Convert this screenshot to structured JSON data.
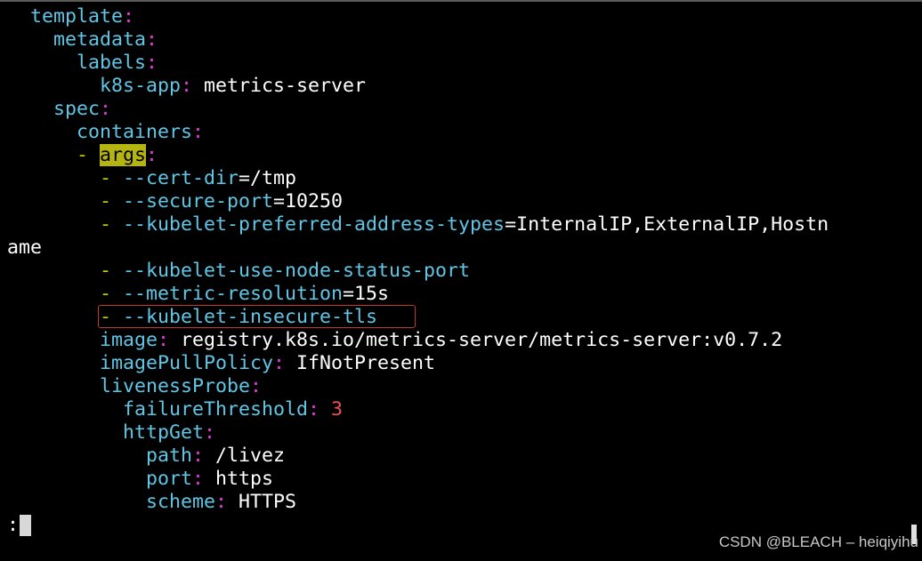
{
  "lines": [
    {
      "indent": "  ",
      "key": "template",
      "colon": ":"
    },
    {
      "indent": "    ",
      "key": "metadata",
      "colon": ":"
    },
    {
      "indent": "      ",
      "key": "labels",
      "colon": ":"
    },
    {
      "indent": "        ",
      "key": "k8s-app",
      "colon": ":",
      "value": " metrics-server"
    },
    {
      "indent": "    ",
      "key": "spec",
      "colon": ":"
    },
    {
      "indent": "      ",
      "key": "containers",
      "colon": ":"
    },
    {
      "indent": "      ",
      "dash": "- ",
      "key_hl": "args",
      "colon": ":"
    },
    {
      "indent": "        ",
      "dash": "- ",
      "flag": "--cert-dir",
      "value": "=/tmp"
    },
    {
      "indent": "        ",
      "dash": "- ",
      "flag": "--secure-port",
      "value": "=10250"
    },
    {
      "indent": "        ",
      "dash": "- ",
      "flag": "--kubelet-preferred-address-types",
      "value": "=InternalIP,ExternalIP,Hostn"
    },
    {
      "plain": "ame"
    },
    {
      "indent": "        ",
      "dash": "- ",
      "flag": "--kubelet-use-node-status-port"
    },
    {
      "indent": "        ",
      "dash": "- ",
      "flag": "--metric-resolution",
      "value": "=15s"
    },
    {
      "indent": "        ",
      "dash": "- ",
      "flag": "--kubelet-insecure-tls",
      "boxed": true
    },
    {
      "indent": "        ",
      "key": "image",
      "colon": ":",
      "value": " registry.k8s.io/metrics-server/metrics-server:v0.7.2"
    },
    {
      "indent": "        ",
      "key": "imagePullPolicy",
      "colon": ":",
      "value": " IfNotPresent"
    },
    {
      "indent": "        ",
      "key": "livenessProbe",
      "colon": ":"
    },
    {
      "indent": "          ",
      "key": "failureThreshold",
      "colon": ":",
      "number": " 3"
    },
    {
      "indent": "          ",
      "key": "httpGet",
      "colon": ":"
    },
    {
      "indent": "            ",
      "key": "path",
      "colon": ":",
      "value": " /livez"
    },
    {
      "indent": "            ",
      "key": "port",
      "colon": ":",
      "value": " https"
    },
    {
      "indent": "            ",
      "key": "scheme",
      "colon": ":",
      "value": " HTTPS"
    }
  ],
  "prompt": ":",
  "watermark": "CSDN @BLEACH – heiqiyihu",
  "colors": {
    "key": "#5fc6e6",
    "colon": "#e23ad6",
    "dash": "#c8c800",
    "number": "#f05050",
    "search_highlight": "#b5b511",
    "annotation_box": "#c0392b"
  }
}
